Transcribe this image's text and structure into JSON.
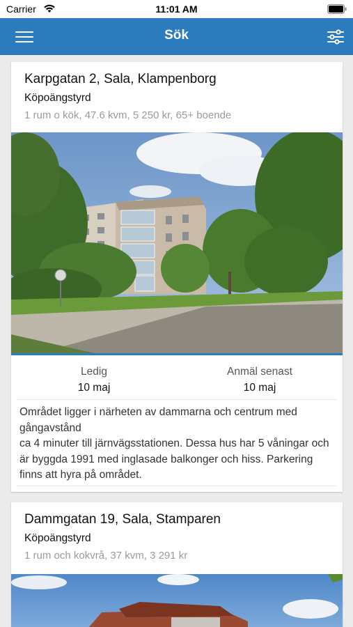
{
  "status_bar": {
    "carrier": "Carrier",
    "time": "11:01 AM"
  },
  "nav": {
    "title": "Sök"
  },
  "listings": [
    {
      "address": "Karpgatan 2, Sala, Klampenborg",
      "type": "Köpoängstyrd",
      "details": "1 rum o kök, 47.6 kvm, 5 250 kr, 65+ boende",
      "available_label": "Ledig",
      "available_value": "10 maj",
      "deadline_label": "Anmäl senast",
      "deadline_value": "10 maj",
      "description": "Området ligger i närheten av dammarna och centrum med gångavstånd\nca 4 minuter till järnvägsstationen. Dessa hus har 5 våningar och är byggda 1991 med inglasade balkonger och hiss. Parkering finns att hyra på området."
    },
    {
      "address": "Dammgatan 19, Sala, Stamparen",
      "type": "Köpoängstyrd",
      "details": "1 rum och kokvrå, 37 kvm, 3 291 kr"
    }
  ],
  "colors": {
    "nav_blue": "#2b7bbd",
    "background": "#ebebeb"
  }
}
